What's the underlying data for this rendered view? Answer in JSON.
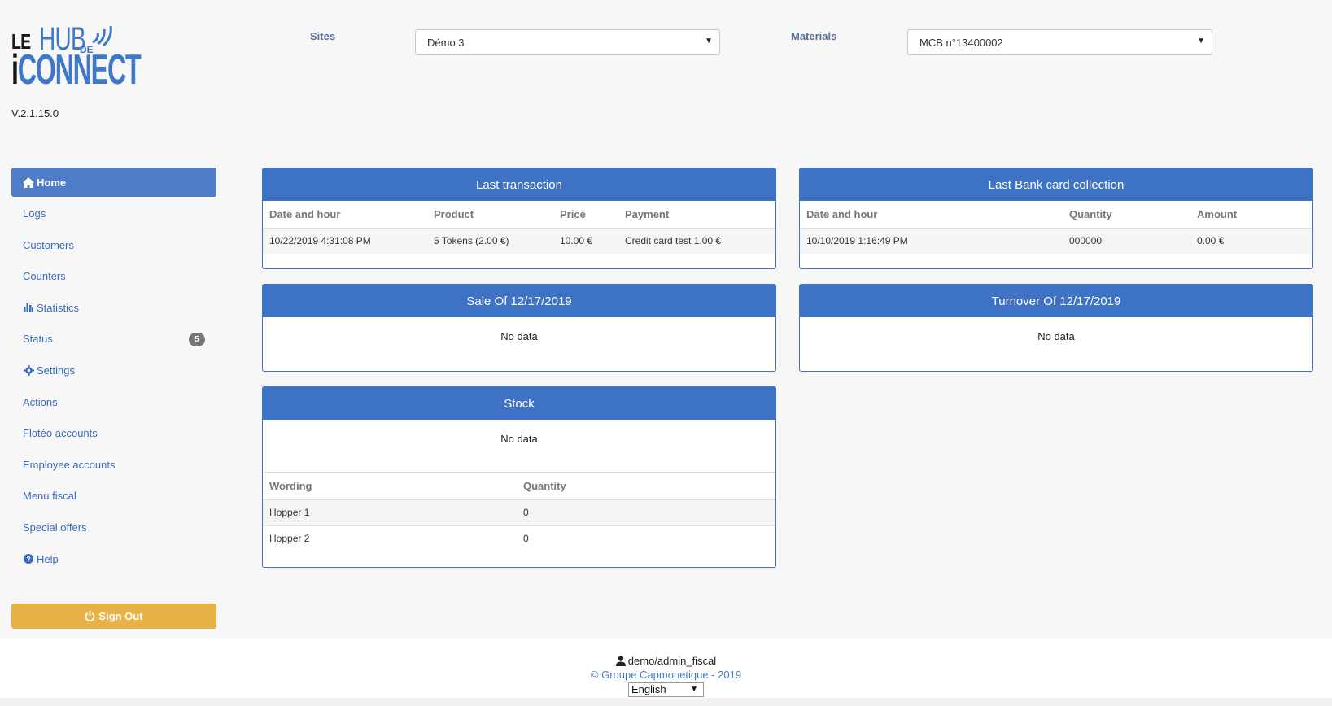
{
  "app": {
    "logo": {
      "le": "LE",
      "hub": "HUB",
      "de": "DE",
      "i": "i",
      "connect": "CONNECT"
    },
    "version": "V.2.1.15.0",
    "accent_color": "#3e72c4",
    "signout_color": "#e8b246"
  },
  "filters": {
    "sites_label": "Sites",
    "sites_value": "Démo 3",
    "materials_label": "Materials",
    "materials_value": "MCB n°13400002"
  },
  "sidebar": {
    "items": [
      {
        "label": "Home",
        "icon": "home-icon"
      },
      {
        "label": "Logs"
      },
      {
        "label": "Customers"
      },
      {
        "label": "Counters"
      },
      {
        "label": "Statistics",
        "icon": "bar-chart-icon"
      },
      {
        "label": "Status",
        "badge": "5"
      },
      {
        "label": "Settings",
        "icon": "gear-icon"
      },
      {
        "label": "Actions"
      },
      {
        "label": "Flotéo accounts"
      },
      {
        "label": "Employee accounts"
      },
      {
        "label": "Menu fiscal"
      },
      {
        "label": "Special offers"
      },
      {
        "label": "Help",
        "icon": "help-icon"
      }
    ],
    "signout_label": "Sign Out"
  },
  "last_transaction": {
    "title": "Last transaction",
    "headers": [
      "Date and hour",
      "Product",
      "Price",
      "Payment"
    ],
    "rows": [
      [
        "10/22/2019 4:31:08 PM",
        "5 Tokens (2.00 €)",
        "10.00 €",
        "Credit card test 1.00 €"
      ]
    ]
  },
  "last_bank_card": {
    "title": "Last Bank card collection",
    "headers": [
      "Date and hour",
      "Quantity",
      "Amount"
    ],
    "rows": [
      [
        "10/10/2019 1:16:49 PM",
        "000000",
        "0.00 €"
      ]
    ]
  },
  "sale": {
    "title": "Sale Of 12/17/2019",
    "nodata": "No data"
  },
  "turnover": {
    "title": "Turnover Of 12/17/2019",
    "nodata": "No data"
  },
  "stock": {
    "title": "Stock",
    "nodata": "No data",
    "headers": [
      "Wording",
      "Quantity"
    ],
    "rows": [
      [
        "Hopper 1",
        "0"
      ],
      [
        "Hopper 2",
        "0"
      ]
    ]
  },
  "footer": {
    "user": "demo/admin_fiscal",
    "copyright": "© Groupe Capmonetique - 2019",
    "language": "English"
  }
}
